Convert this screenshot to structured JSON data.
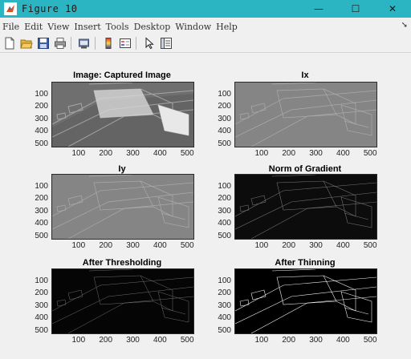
{
  "window": {
    "title": "Figure 10",
    "controls": {
      "minimize": "—",
      "maximize": "☐",
      "close": "✕"
    }
  },
  "menubar": {
    "items": [
      "File",
      "Edit",
      "View",
      "Insert",
      "Tools",
      "Desktop",
      "Window",
      "Help"
    ],
    "dock_arrow": "➘"
  },
  "toolbar": {
    "buttons": [
      "new-figure-icon",
      "open-file-icon",
      "save-icon",
      "print-icon",
      "print-preview-icon",
      "colorbar-icon",
      "legend-icon",
      "pointer-icon",
      "property-editor-icon"
    ]
  },
  "subplots": [
    {
      "title": "Image: Captured Image",
      "style": "photo"
    },
    {
      "title": "Ix",
      "style": "emboss"
    },
    {
      "title": "Iy",
      "style": "emboss"
    },
    {
      "title": "Norm of Gradient",
      "style": "gradient"
    },
    {
      "title": "After Thresholding",
      "style": "threshold"
    },
    {
      "title": "After Thinning",
      "style": "thin"
    }
  ],
  "axis_ticks": {
    "y": [
      "100",
      "200",
      "300",
      "400",
      "500"
    ],
    "x": [
      "100",
      "200",
      "300",
      "400",
      "500"
    ]
  },
  "colors": {
    "titlebar": "#2bb5c3",
    "window_bg": "#f0f0f0"
  }
}
